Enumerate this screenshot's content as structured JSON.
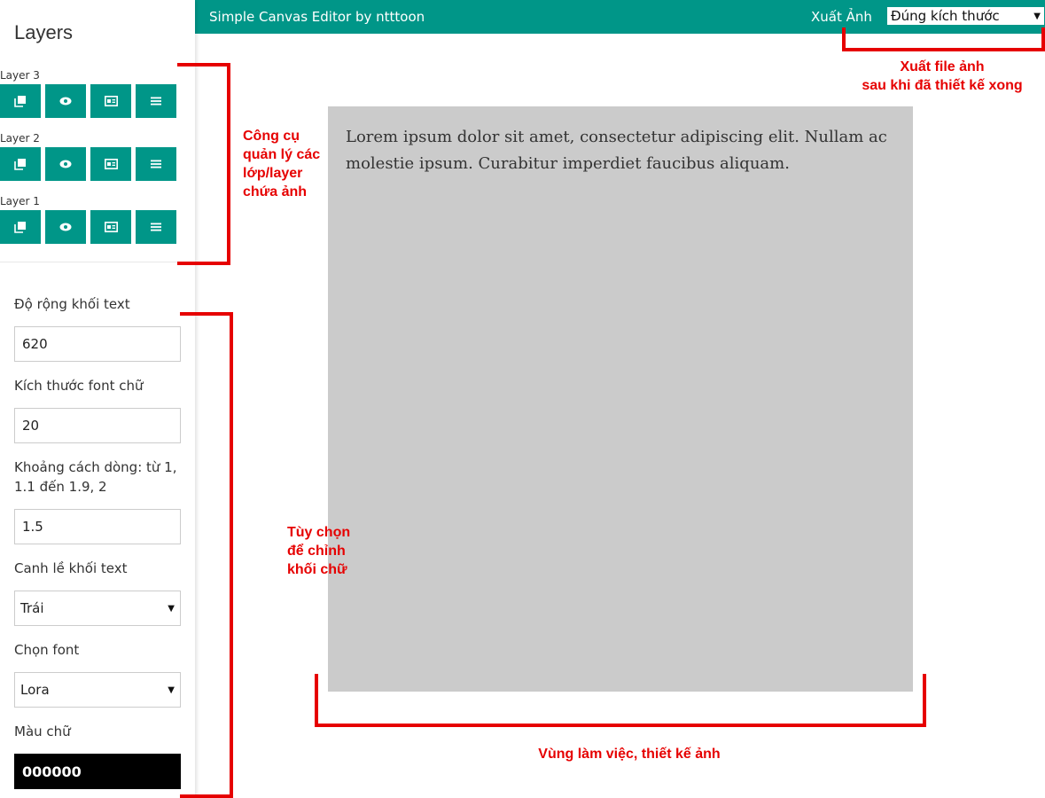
{
  "sidebar": {
    "title": "Layers",
    "layers": [
      {
        "name": "Layer 3"
      },
      {
        "name": "Layer 2"
      },
      {
        "name": "Layer 1"
      }
    ],
    "layer_tool_icons": [
      "copy-icon",
      "eye-icon",
      "image-icon",
      "menu-icon"
    ],
    "fields": {
      "text_width": {
        "label": "Độ rộng khối text",
        "value": "620"
      },
      "font_size": {
        "label": "Kích thước font chữ",
        "value": "20"
      },
      "line_height": {
        "label": "Khoảng cách dòng: từ 1, 1.1 đến 1.9, 2",
        "value": "1.5"
      },
      "text_align": {
        "label": "Canh lề khối text",
        "selected": "Trái"
      },
      "font": {
        "label": "Chọn font",
        "selected": "Lora"
      },
      "text_color": {
        "label": "Màu chữ",
        "value": "000000"
      }
    }
  },
  "topbar": {
    "title": "Simple Canvas Editor by ntttoon",
    "export_label": "Xuất Ảnh",
    "export_selected": "Đúng kích thước",
    "color": "#009688"
  },
  "canvas": {
    "text": "Lorem ipsum dolor sit amet, consectetur adipiscing elit. Nullam ac molestie ipsum. Curabitur imperdiet faucibus aliquam.",
    "background": "#cbcbcb"
  },
  "annotations": {
    "layer_tools": [
      "Công cụ",
      "quản lý các",
      "lớp/layer",
      "chứa ảnh"
    ],
    "text_options": [
      "Tùy chọn",
      "để chỉnh",
      "khối chữ"
    ],
    "export": [
      "Xuất file ảnh",
      "sau khi đã thiết kế xong"
    ],
    "workspace": "Vùng làm việc, thiết kế ảnh",
    "color": "#e60000"
  }
}
